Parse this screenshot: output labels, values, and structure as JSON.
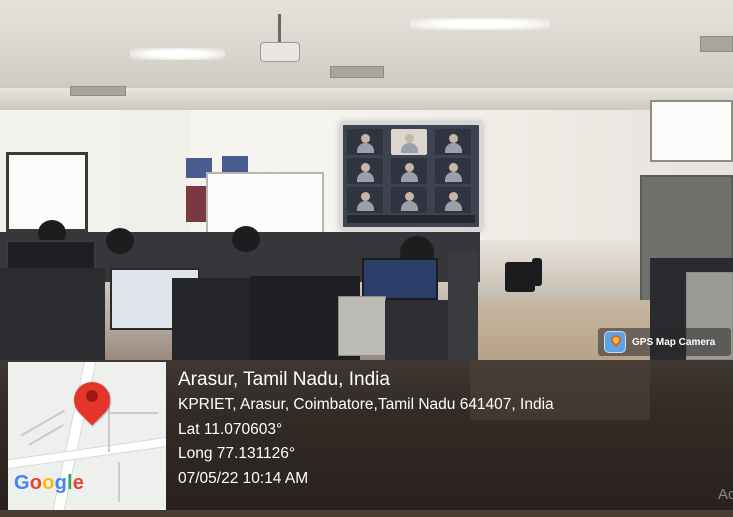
{
  "photo": {
    "scene": "computer-lab"
  },
  "gps_badge": {
    "label": "GPS Map Camera",
    "icon": "gps-map-camera-icon",
    "color": "#5aa5e6"
  },
  "location": {
    "title": "Arasur, Tamil Nadu, India",
    "address": "KPRIET, Arasur, Coimbatore,Tamil Nadu 641407, India",
    "latitude": "Lat 11.070603°",
    "longitude": "Long 77.131126°",
    "datetime": "07/05/22 10:14 AM"
  },
  "map": {
    "provider": "Google",
    "pin_icon": "location-pin-icon",
    "pin_color": "#e5352b"
  },
  "watermark": "Ac"
}
